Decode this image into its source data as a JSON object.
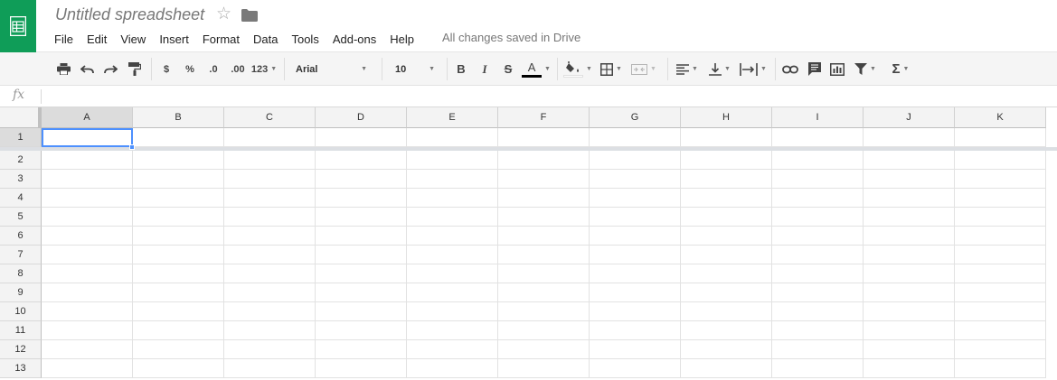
{
  "app": {
    "doc_title": "Untitled spreadsheet",
    "save_status": "All changes saved in Drive",
    "logo_icon": "sheets-logo-icon",
    "brand_color": "#0f9d58"
  },
  "menu": [
    "File",
    "Edit",
    "View",
    "Insert",
    "Format",
    "Data",
    "Tools",
    "Add-ons",
    "Help"
  ],
  "toolbar": {
    "currency": "$",
    "percent": "%",
    "decrease_decimals": ".0",
    "increase_decimals": ".00",
    "more_formats": "123",
    "font": "Arial",
    "font_size": "10",
    "bold": "B",
    "italic": "I",
    "strikethrough": "S",
    "text_color": "A",
    "text_color_value": "#000000",
    "functions": "Σ",
    "icons": [
      "print-icon",
      "undo-icon",
      "redo-icon",
      "paint-format-icon",
      "fill-color-icon",
      "borders-icon",
      "merge-cells-icon",
      "align-icon",
      "vertical-align-icon",
      "text-wrap-icon",
      "link-icon",
      "comment-icon",
      "chart-icon",
      "filter-icon"
    ]
  },
  "formula_bar": {
    "label": "fx",
    "value": ""
  },
  "grid": {
    "columns": [
      "A",
      "B",
      "C",
      "D",
      "E",
      "F",
      "G",
      "H",
      "I",
      "J",
      "K"
    ],
    "rows": [
      "1",
      "2",
      "3",
      "4",
      "5",
      "6",
      "7",
      "8",
      "9",
      "10",
      "11",
      "12",
      "13"
    ],
    "active_cell": "A1",
    "frozen_rows": 1,
    "selection_color": "#4d90fe"
  }
}
